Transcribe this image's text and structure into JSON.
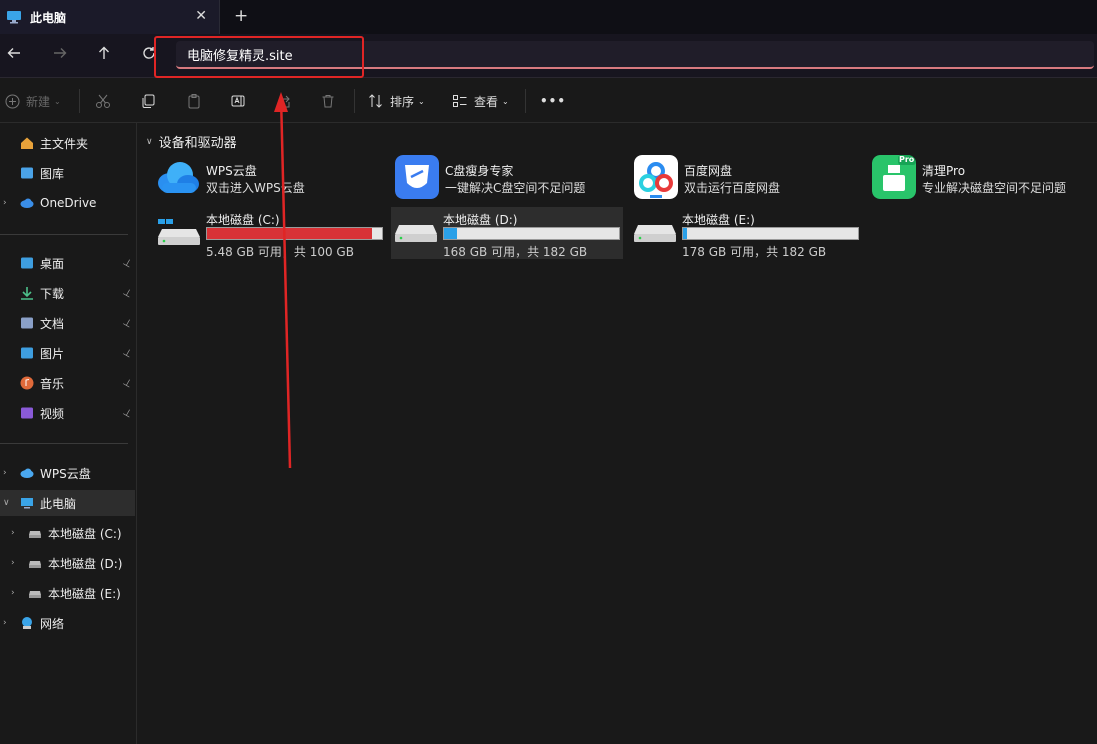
{
  "window": {
    "tab_title": "此电脑",
    "tab_close": "✕",
    "new_tab": "+"
  },
  "address": {
    "value": "电脑修复精灵.site"
  },
  "toolbar": {
    "new_label": "新建",
    "sort_label": "排序",
    "view_label": "查看",
    "more_label": "•••"
  },
  "sidebar": {
    "quick": [
      {
        "label": "主文件夹",
        "icon": "home-icon",
        "color": "#e8a23a"
      },
      {
        "label": "图库",
        "icon": "gallery-icon",
        "color": "#4aa3e8"
      },
      {
        "label": "OneDrive",
        "icon": "cloud-icon",
        "color": "#3a8ee8"
      }
    ],
    "pinned": [
      {
        "label": "桌面",
        "icon": "desktop-icon",
        "color": "#3e9ee0"
      },
      {
        "label": "下载",
        "icon": "download-icon",
        "color": "#4cc08a"
      },
      {
        "label": "文档",
        "icon": "document-icon",
        "color": "#8aa0c8"
      },
      {
        "label": "图片",
        "icon": "pictures-icon",
        "color": "#3e9ee0"
      },
      {
        "label": "音乐",
        "icon": "music-icon",
        "color": "#e06a3a"
      },
      {
        "label": "视频",
        "icon": "video-icon",
        "color": "#8a5ad8"
      }
    ],
    "tree": [
      {
        "label": "WPS云盘",
        "icon": "cloud-icon",
        "color": "#4aa8f0",
        "indent": 0
      },
      {
        "label": "此电脑",
        "icon": "computer-icon",
        "color": "#3aa4e8",
        "indent": 0
      },
      {
        "label": "本地磁盘 (C:)",
        "icon": "drive-icon",
        "color": "#bbbbbb",
        "indent": 1
      },
      {
        "label": "本地磁盘 (D:)",
        "icon": "drive-icon",
        "color": "#bbbbbb",
        "indent": 1
      },
      {
        "label": "本地磁盘 (E:)",
        "icon": "drive-icon",
        "color": "#bbbbbb",
        "indent": 1
      },
      {
        "label": "网络",
        "icon": "network-icon",
        "color": "#3aa4e8",
        "indent": 0
      }
    ]
  },
  "content": {
    "group_title": "设备和驱动器",
    "apps": [
      {
        "name": "WPS云盘",
        "desc": "双击进入WPS云盘",
        "icon": "wps-cloud-icon"
      },
      {
        "name": "C盘瘦身专家",
        "desc": "一键解决C盘空间不足问题",
        "icon": "c-slim-icon"
      },
      {
        "name": "百度网盘",
        "desc": "双击运行百度网盘",
        "icon": "baidu-netdisk-icon"
      },
      {
        "name": "清理Pro",
        "desc": "专业解决磁盘空间不足问题",
        "icon": "cleaner-pro-icon",
        "badge": "Pro"
      }
    ],
    "drives": [
      {
        "name": "本地磁盘 (C:)",
        "size": "5.48 GB 可用，共 100 GB",
        "used_fraction": 0.945,
        "bar_color": "#d83236"
      },
      {
        "name": "本地磁盘 (D:)",
        "size": "168 GB 可用，共 182 GB",
        "used_fraction": 0.077,
        "bar_color": "#2aa0e8"
      },
      {
        "name": "本地磁盘 (E:)",
        "size": "178 GB 可用，共 182 GB",
        "used_fraction": 0.022,
        "bar_color": "#2aa0e8"
      }
    ]
  },
  "colors": {
    "accent_red": "#e02525",
    "address_underline": "#d77a7f"
  }
}
